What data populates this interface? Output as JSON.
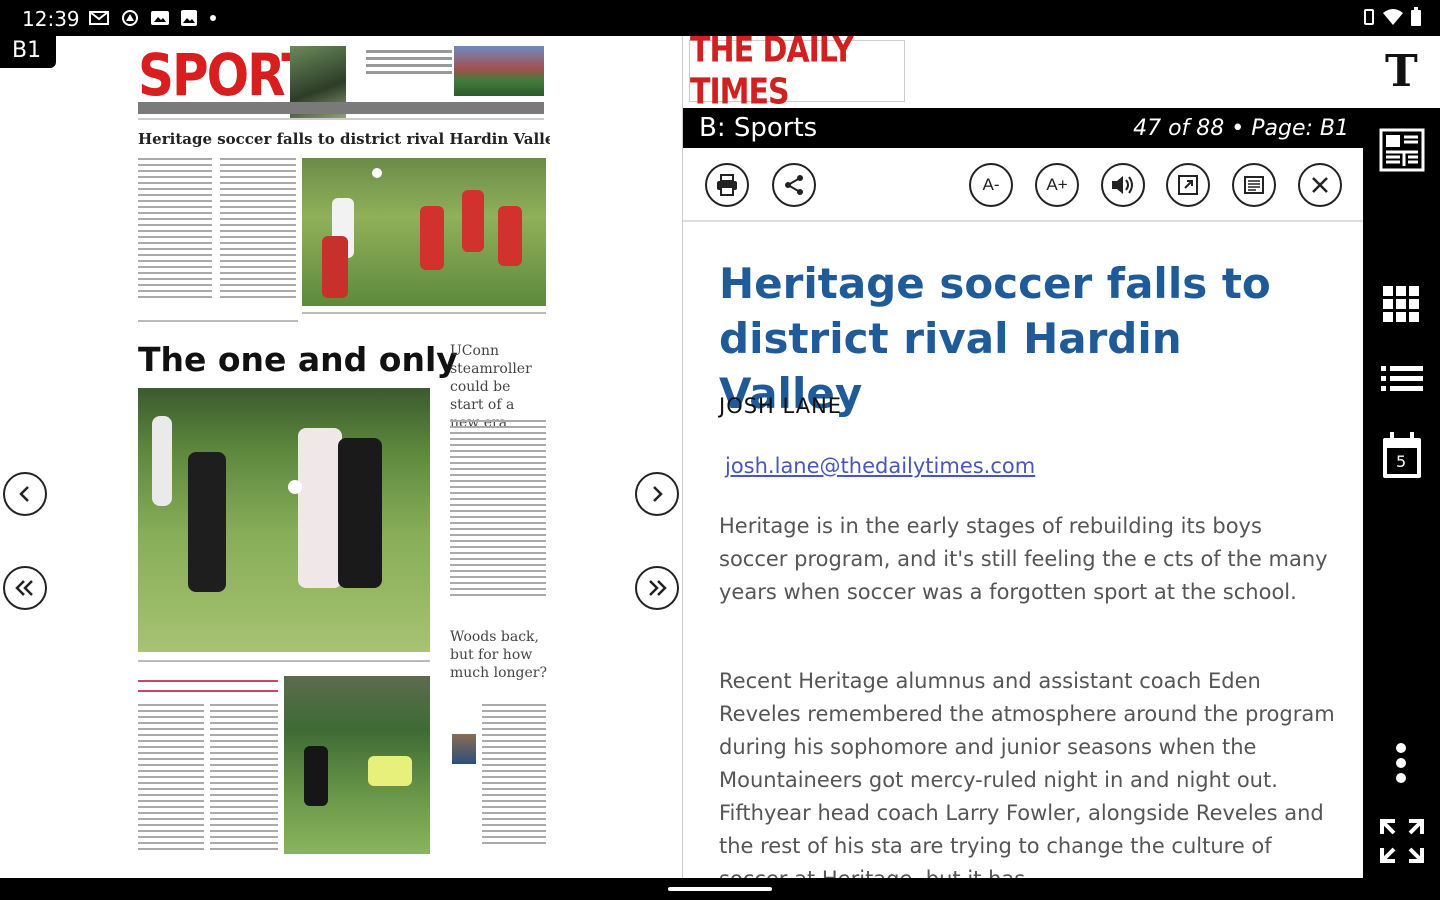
{
  "status_bar": {
    "time": "12:39"
  },
  "page_badge": "B1",
  "newspaper": {
    "masthead": "SPORTS",
    "headline_top": "Heritage soccer falls to district rival Hardin Valley",
    "headline_feature": "The one and only",
    "side_story_1": "UConn steamroller could be start of a new era",
    "side_story_2": "Woods back, but for how much longer?"
  },
  "reader": {
    "logo": "THE DAILY TIMES",
    "section": "B: Sports",
    "position": "47 of 88 • Page: B1",
    "toolbar": {
      "print_icon": "printer-icon",
      "share_icon": "share-icon",
      "font_decrease": "A-",
      "font_increase": "A+",
      "audio_icon": "speaker-icon",
      "expand_icon": "expand-icon",
      "pageview_icon": "page-view-icon",
      "close_icon": "close-icon"
    },
    "article": {
      "title": "Heritage soccer falls to district rival Hardin Valley",
      "author": "JOSH LANE",
      "email": "josh.lane@thedailytimes.com",
      "paragraph_1": "Heritage is in the early stages of rebuilding its boys soccer program, and it's still feeling the e cts of the many years when soccer was a forgotten sport at the school.",
      "paragraph_2": "Recent Heritage alumnus and assistant coach Eden Reveles remembered the atmosphere around the program during his sophomore and junior seasons when the Mountaineers got mercy-ruled night in and night out. Fifthyear head coach Larry Fowler, alongside Reveles and the rest of his sta are trying to change the culture of soccer at Heritage, but it has"
    }
  },
  "sidebar": {
    "text_mode_label": "T",
    "calendar_day": "5"
  },
  "colors": {
    "title_blue": "#1f5b99",
    "logo_red": "#d0201f",
    "link": "#4a56b8"
  }
}
